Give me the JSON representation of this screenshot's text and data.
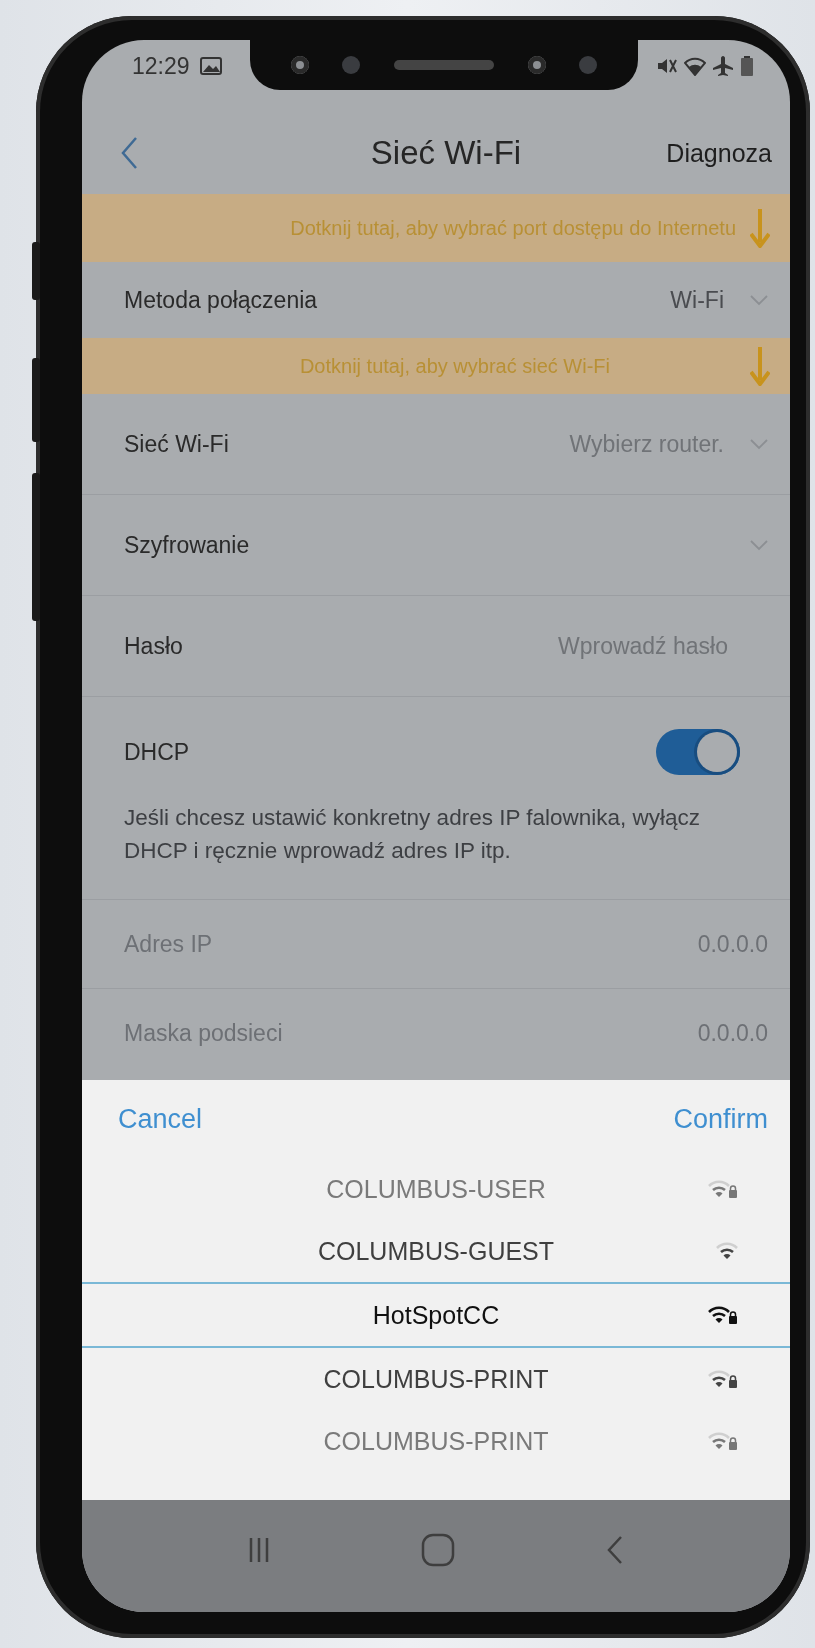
{
  "status_bar": {
    "time": "12:29"
  },
  "header": {
    "title": "Sieć Wi-Fi",
    "action": "Diagnoza"
  },
  "form": [
    {
      "kind": "banner",
      "text": "Dotknij tutaj, aby wybrać port dostępu do Internetu"
    },
    {
      "kind": "select",
      "label": "Metoda połączenia",
      "value": "Wi-Fi"
    },
    {
      "kind": "banner",
      "text": "Dotknij tutaj, aby wybrać sieć Wi-Fi"
    },
    {
      "kind": "select",
      "label": "Sieć Wi-Fi",
      "placeholder": "Wybierz router."
    },
    {
      "kind": "select",
      "label": "Szyfrowanie"
    },
    {
      "kind": "input",
      "label": "Hasło",
      "placeholder": "Wprowadź hasło"
    },
    {
      "kind": "toggle",
      "label": "DHCP",
      "on": true,
      "note": "Jeśli chcesz ustawić konkretny adres IP falownika, wyłącz DHCP i ręcznie wprowadź adres IP itp."
    },
    {
      "kind": "readonly",
      "label": "Adres IP",
      "value": "0.0.0.0"
    },
    {
      "kind": "readonly",
      "label": "Maska podsieci",
      "value": "0.0.0.0"
    }
  ],
  "picker": {
    "cancel": "Cancel",
    "confirm": "Confirm",
    "options": [
      {
        "label": "COLUMBUS-USER",
        "locked": true,
        "selected": false
      },
      {
        "label": "COLUMBUS-GUEST",
        "locked": false,
        "selected": false
      },
      {
        "label": "HotSpotCC",
        "locked": true,
        "selected": true
      },
      {
        "label": "COLUMBUS-PRINT",
        "locked": true,
        "selected": false
      },
      {
        "label": "COLUMBUS-PRINT",
        "locked": true,
        "selected": false
      }
    ]
  }
}
